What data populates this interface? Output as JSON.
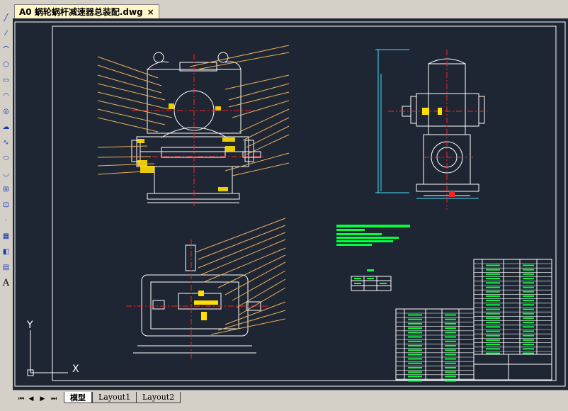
{
  "document": {
    "tab_title": "A0 蜗轮蜗杆减速器总装配.dwg",
    "close_symbol": "×"
  },
  "layout_tabs": [
    {
      "label": "模型",
      "active": true
    },
    {
      "label": "Layout1",
      "active": false
    },
    {
      "label": "Layout2",
      "active": false
    }
  ],
  "nav": {
    "first": "⏮",
    "prev": "◀",
    "next": "▶",
    "last": "⏭"
  },
  "ucs": {
    "y_label": "Y",
    "x_label": "X"
  },
  "toolbar_icons": [
    "line-icon",
    "construction-line-icon",
    "polyline-icon",
    "polygon-icon",
    "rectangle-icon",
    "arc-icon",
    "circle-icon",
    "revision-cloud-icon",
    "spline-icon",
    "ellipse-icon",
    "ellipse-arc-icon",
    "insert-block-icon",
    "make-block-icon",
    "point-icon",
    "hatch-icon",
    "region-icon",
    "table-icon",
    "multiline-text-icon"
  ],
  "toolbar_glyph_text": "A",
  "colors": {
    "canvas": "#1f2633",
    "drawing_lines": "#ffffff",
    "leaders": "#e8b060",
    "center_lines": "#ff2020",
    "dimensions": "#40e0ff",
    "hatch": "#ffe000",
    "text_blocks": "#00ff40"
  }
}
